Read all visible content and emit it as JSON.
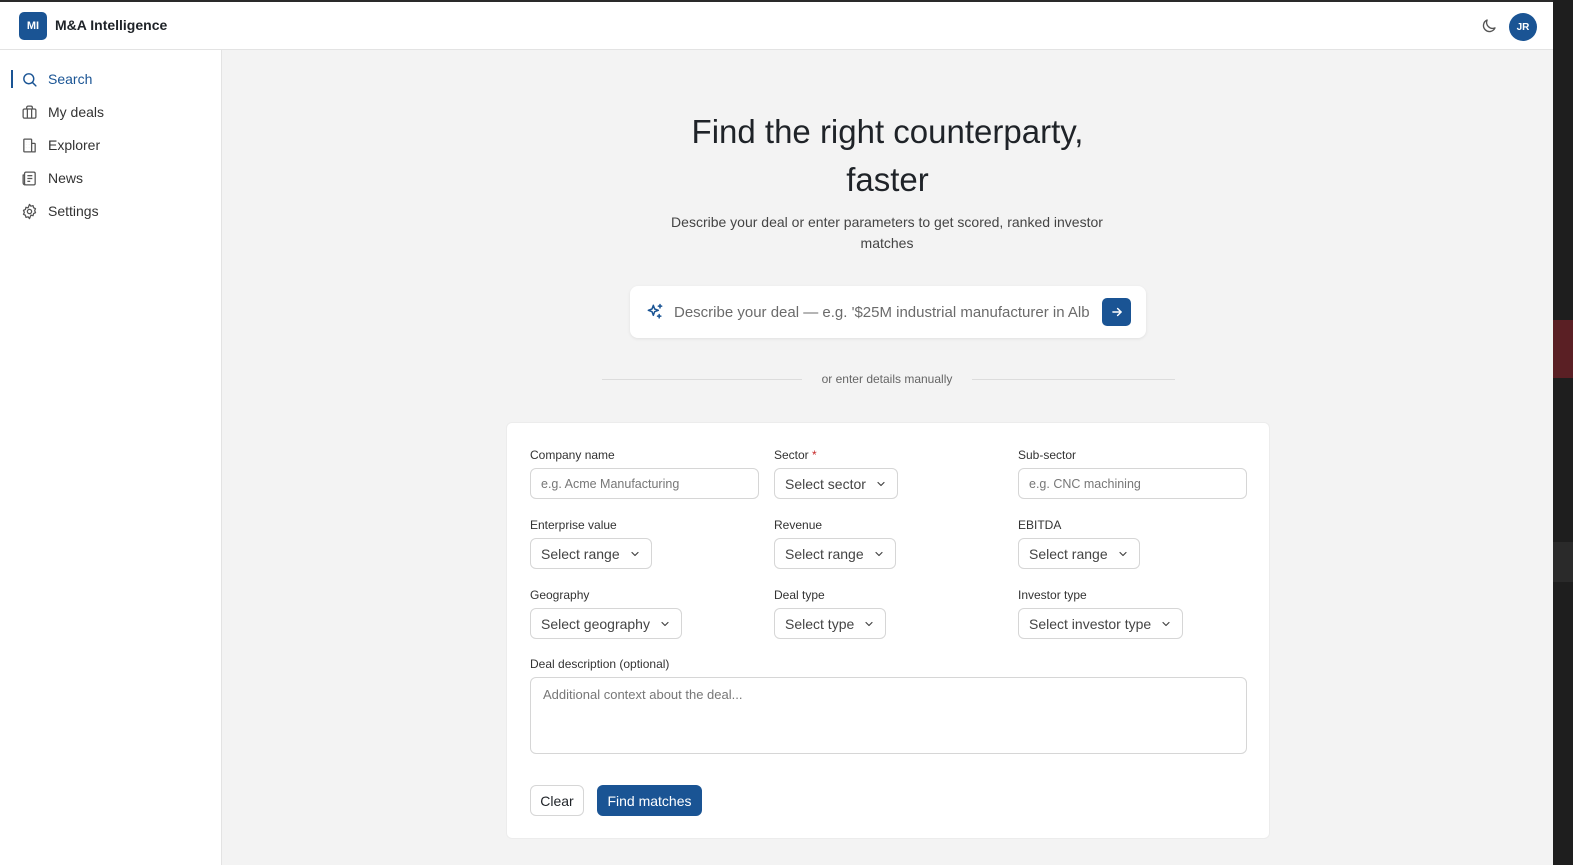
{
  "header": {
    "logo_initials": "MI",
    "app_title": "M&A Intelligence",
    "user_initials": "JR"
  },
  "sidebar": {
    "items": [
      {
        "label": "Search",
        "icon": "search-icon",
        "active": true
      },
      {
        "label": "My deals",
        "icon": "briefcase-icon",
        "active": false
      },
      {
        "label": "Explorer",
        "icon": "building-icon",
        "active": false
      },
      {
        "label": "News",
        "icon": "newspaper-icon",
        "active": false
      },
      {
        "label": "Settings",
        "icon": "gear-icon",
        "active": false
      }
    ]
  },
  "hero": {
    "title_line1": "Find the right counterparty,",
    "title_line2": "faster",
    "subtitle": "Describe your deal or enter parameters to get scored, ranked investor matches"
  },
  "ai_search": {
    "placeholder": "Describe your deal — e.g. '$25M industrial manufacturer in Alb"
  },
  "divider_text": "or enter details manually",
  "form": {
    "company_name": {
      "label": "Company name",
      "placeholder": "e.g. Acme Manufacturing"
    },
    "sector": {
      "label": "Sector",
      "required_mark": "*",
      "value": "Select sector"
    },
    "sub_sector": {
      "label": "Sub-sector",
      "placeholder": "e.g. CNC machining"
    },
    "enterprise_value": {
      "label": "Enterprise value",
      "value": "Select range"
    },
    "revenue": {
      "label": "Revenue",
      "value": "Select range"
    },
    "ebitda": {
      "label": "EBITDA",
      "value": "Select range"
    },
    "geography": {
      "label": "Geography",
      "value": "Select geography"
    },
    "deal_type": {
      "label": "Deal type",
      "value": "Select type"
    },
    "investor_type": {
      "label": "Investor type",
      "value": "Select investor type"
    },
    "deal_description": {
      "label": "Deal description (optional)",
      "placeholder": "Additional context about the deal..."
    },
    "clear_label": "Clear",
    "find_label": "Find matches"
  },
  "colors": {
    "accent": "#1a5494",
    "background": "#f3f3f3",
    "required": "#c62828"
  }
}
